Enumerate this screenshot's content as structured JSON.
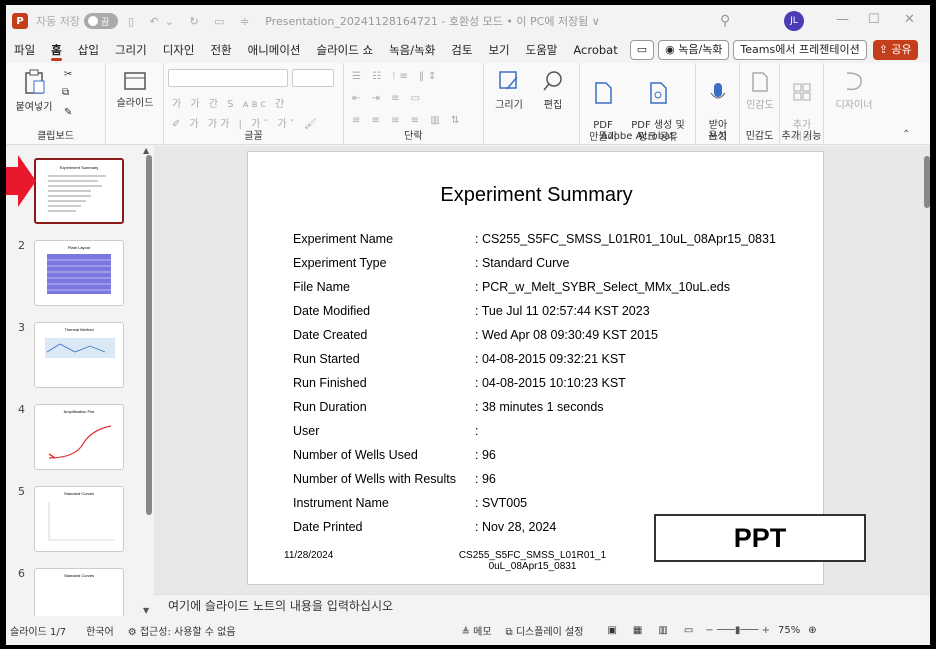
{
  "titlebar": {
    "logo": "P",
    "autosave": "자동 저장",
    "autosave_state": "끔",
    "doc_title": "Presentation_20241128164721  -  호환성 모드 • 이 PC에 저장됨 ∨",
    "user_initials": "JL"
  },
  "menu": {
    "tabs": [
      "파일",
      "홈",
      "삽입",
      "그리기",
      "디자인",
      "전환",
      "애니메이션",
      "슬라이드 쇼",
      "녹음/녹화",
      "검토",
      "보기",
      "도움말",
      "Acrobat"
    ],
    "record_btn": "◉ 녹음/녹화",
    "teams_btn": "Teams에서 프레젠테이션",
    "share_btn": "공유"
  },
  "ribbon": {
    "paste": "붙여넣기",
    "slide": "슬라이드",
    "draw": "그리기",
    "edit": "편집",
    "pdf_create": "PDF\n만들기",
    "pdf_share": "PDF 생성 및\n링크 공유",
    "dictate": "받아\n쓰기",
    "sensitivity": "민감도",
    "addins": "추가\n기능",
    "designer": "디자이너",
    "groups": {
      "clipboard": "클립보드",
      "font": "글꼴",
      "paragraph": "단락",
      "acrobat": "Adobe Acrobat",
      "voice": "음성",
      "sensitivity": "민감도",
      "addins": "추가 기능"
    }
  },
  "thumbs": [
    {
      "num": "",
      "title": "Experiment Summary"
    },
    {
      "num": "2",
      "title": "Plate Layout"
    },
    {
      "num": "3",
      "title": "Thermal Method"
    },
    {
      "num": "4",
      "title": "Amplification Plot"
    },
    {
      "num": "5",
      "title": "Standard Curves"
    },
    {
      "num": "6",
      "title": "Standard Curves"
    }
  ],
  "slide": {
    "title": "Experiment Summary",
    "rows": [
      {
        "k": "Experiment Name",
        "v": ": CS255_S5FC_SMSS_L01R01_10uL_08Apr15_0831"
      },
      {
        "k": "Experiment Type",
        "v": ": Standard Curve"
      },
      {
        "k": "File Name",
        "v": ": PCR_w_Melt_SYBR_Select_MMx_10uL.eds"
      },
      {
        "k": "Date Modified",
        "v": ": Tue Jul 11 02:57:44 KST 2023"
      },
      {
        "k": "Date Created",
        "v": ": Wed Apr 08 09:30:49 KST 2015"
      },
      {
        "k": "Run Started",
        "v": ": 04-08-2015 09:32:21 KST"
      },
      {
        "k": "Run Finished",
        "v": ": 04-08-2015 10:10:23 KST"
      },
      {
        "k": "Run Duration",
        "v": ": 38 minutes 1 seconds"
      },
      {
        "k": "User",
        "v": ":"
      },
      {
        "k": "Number of Wells Used",
        "v": ": 96"
      },
      {
        "k": "Number of Wells with Results",
        "v": ": 96"
      },
      {
        "k": "Instrument Name",
        "v": ": SVT005"
      },
      {
        "k": "Date Printed",
        "v": ": Nov 28, 2024"
      }
    ],
    "footer_date": "11/28/2024",
    "footer_name": "CS255_S5FC_SMSS_L01R01_1\n0uL_08Apr15_0831",
    "stamp": "PPT"
  },
  "notes_placeholder": "여기에 슬라이드 노트의 내용을 입력하십시오",
  "status": {
    "slide_count": "슬라이드 1/7",
    "language": "한국어",
    "accessibility": "접근성: 사용할 수 없음",
    "notes": "메모",
    "display": "디스플레이 설정",
    "zoom": "75%"
  },
  "colors": {
    "accent": "#c43e1c",
    "selected_border": "#8b1a1a",
    "arrow": "#e8192c"
  }
}
